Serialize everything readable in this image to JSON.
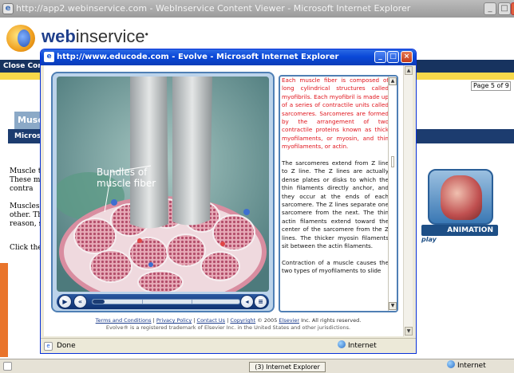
{
  "back_window": {
    "title": "http://app2.webinservice.com - WebInservice Content Viewer - Microsoft Internet Explorer",
    "logo_bold": "web",
    "logo_rest": "inservice",
    "logo_mark": "•",
    "bar_text": "Close Conte",
    "page_indicator": "Page 5 of 9",
    "section_title": "Musc",
    "section_subtitle": "Micros",
    "paragraphs": [
      "Muscle ti These mu or contra",
      "Muscles other. Th reason, s",
      "Click the"
    ],
    "animation_label": "ANIMATION",
    "play_label": "play",
    "status_internet": "Internet",
    "taskbar_button": "(3) Internet Explorer"
  },
  "popup": {
    "title": "http://www.educode.com - Evolve - Microsoft Internet Explorer",
    "video_label_line1": "Bundles of",
    "video_label_line2": "muscle fiber",
    "text_paragraphs": [
      {
        "text": "Each muscle fiber is composed of long cylindrical structures called myofibrils. Each myofibril is made up of a series of contractile units called sarcomeres. Sarcomeres are formed by the arrangement of two contractile proteins known as thick myofilaments, or myosin, and thin myofilaments, or actin.",
        "style": "red"
      },
      {
        "text": "The sarcomeres extend from Z line to Z line. The Z lines are actually dense plates or disks to which the thin filaments directly anchor, and they occur at the ends of each sarcomere. The Z lines separate one sarcomere from the next. The thin actin filaments extend toward the center of the sarcomere from the Z lines. The thicker myosin filaments sit between the actin filaments.",
        "style": "normal"
      },
      {
        "text": "Contraction of a muscle causes the two types of myofilaments to slide",
        "style": "normal"
      }
    ],
    "footer_links": [
      "Terms and Conditions",
      "Privacy Policy",
      "Contact Us",
      "Copyright"
    ],
    "footer_copyright": "© 2005",
    "footer_elsevier": "Elsevier",
    "footer_rights": "Inc. All rights reserved.",
    "footer_note": "Evolve® is a registered trademark of Elsevier Inc. in the United States and other jurisdictions.",
    "status_done": "Done",
    "status_internet": "Internet",
    "video_progress": 0.08
  },
  "colors": {
    "popup_titlebar": "#0a48d8",
    "highlight_text": "#e0141c",
    "nav_dark": "#17335f",
    "accent_orange": "#e9742b"
  }
}
